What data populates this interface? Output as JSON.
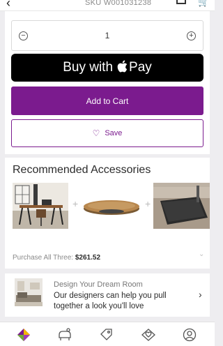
{
  "header": {
    "back_icon": "chevron-left-icon",
    "sku": "SKU W001031238",
    "box_icon": "box-icon",
    "cart_icon": "cart-icon"
  },
  "purchase": {
    "quantity": "1",
    "decrement_icon": "minus-icon",
    "increment_icon": "plus-icon",
    "apple_pay_prefix": "Buy with",
    "apple_pay_suffix": "Pay",
    "add_to_cart_label": "Add to Cart",
    "save_label": "Save",
    "accent_color": "#7b1b8e"
  },
  "accessories": {
    "title": "Recommended Accessories",
    "items": [
      {
        "name": "desk-room-image"
      },
      {
        "name": "wobble-board-image"
      },
      {
        "name": "anti-fatigue-mat-image"
      }
    ],
    "total_label": "Purchase All Three:",
    "total_price": "$261.52"
  },
  "design_room": {
    "title": "Design Your Dream Room",
    "body": "Our designers can help you pull together a look you'll love"
  },
  "bottom_nav": [
    {
      "icon": "home-logo-icon"
    },
    {
      "icon": "rooms-icon"
    },
    {
      "icon": "sale-tag-icon"
    },
    {
      "icon": "favorites-icon"
    },
    {
      "icon": "account-icon"
    }
  ]
}
